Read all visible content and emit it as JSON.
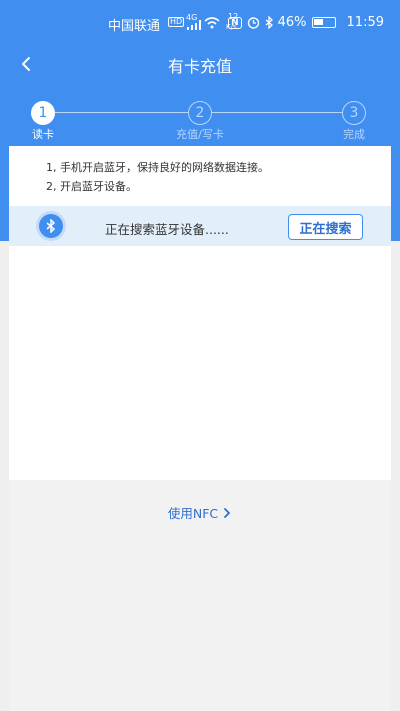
{
  "status_bar": {
    "carrier": "中国联通",
    "hd": "HD",
    "net": "4G",
    "speed_value": "12",
    "speed_unit": "K/s",
    "nfc": "N",
    "battery": "46%",
    "time": "11:59"
  },
  "header": {
    "title": "有卡充值",
    "back_icon": "chevron-left-icon"
  },
  "steps": [
    {
      "number": "1",
      "label": "读卡",
      "active": true
    },
    {
      "number": "2",
      "label": "充值/写卡",
      "active": false
    },
    {
      "number": "3",
      "label": "完成",
      "active": false
    }
  ],
  "instructions": [
    "1, 手机开启蓝牙，保持良好的网络数据连接。",
    "2, 开启蓝牙设备。"
  ],
  "search": {
    "icon": "bluetooth-icon",
    "status_text": "正在搜索蓝牙设备......",
    "button_label": "正在搜索"
  },
  "nfc": {
    "link_label": "使用NFC",
    "icon": "chevron-right-icon"
  },
  "colors": {
    "primary": "#3f8ef0",
    "link": "#2f6fcf"
  }
}
